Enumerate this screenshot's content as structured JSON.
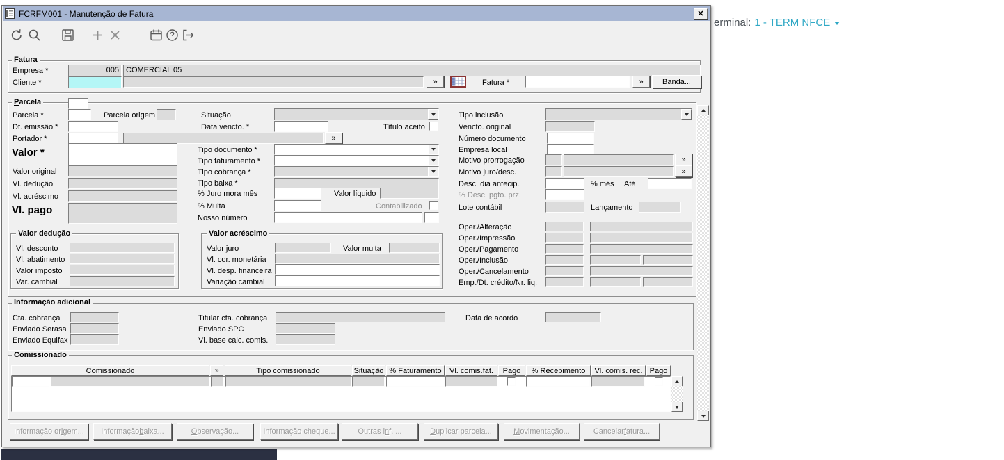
{
  "colors": {
    "titlebar": "#a7b6d3",
    "accent": "#2fa8c5",
    "field_readonly": "#dcdcdc",
    "field_highlight": "#b4f6f6",
    "navy_bar": "#2b3042"
  },
  "glyphs": {
    "lookup": "»",
    "close": "✕"
  },
  "window": {
    "title": "FCRFM001 - Manutenção de Fatura"
  },
  "background_app": {
    "terminal_label": "erminal:",
    "terminal_value": "1 - TERM NFCE"
  },
  "toolbar": {
    "icons": [
      "refresh",
      "search",
      "save",
      "add",
      "delete",
      "calendar",
      "help",
      "exit"
    ]
  },
  "fatura": {
    "group_label": "Fatura",
    "empresa_label": "Empresa *",
    "empresa_code": "005",
    "empresa_name": "COMERCIAL 05",
    "cliente_label": "Cliente *",
    "fatura_label": "Fatura *",
    "banda_button": "Banda..."
  },
  "parcela": {
    "group_label": "Parcela",
    "parcela_label": "Parcela *",
    "parcela_origem_label": "Parcela origem",
    "situacao_label": "Situação",
    "tipo_inclusao_label": "Tipo inclusão",
    "dt_emissao_label": "Dt. emissão *",
    "data_vencto_label": "Data vencto. *",
    "titulo_aceito_label": "Título aceito",
    "vencto_original_label": "Vencto. original",
    "portador_label": "Portador *",
    "numero_documento_label": "Número documento",
    "empresa_local_label": "Empresa local",
    "valor_label": "Valor *",
    "tipo_documento_label": "Tipo documento *",
    "tipo_faturamento_label": "Tipo faturamento *",
    "tipo_cobranca_label": "Tipo cobrança *",
    "tipo_baixa_label": "Tipo baixa *",
    "motivo_prorrogacao_label": "Motivo prorrogação",
    "motivo_juro_desc_label": "Motivo juro/desc.",
    "valor_original_label": "Valor original",
    "vl_deducao_label": "Vl. dedução",
    "vl_acrescimo_label": "Vl. acréscimo",
    "vl_pago_label": "Vl. pago",
    "desc_dia_antecip_label": "Desc. dia antecip.",
    "pct_mes_label": "% mês",
    "ate_label": "Até",
    "pct_desc_pgto_label": "% Desc. pgto. prz.",
    "juro_mora_label": "% Juro mora mês",
    "valor_liquido_label": "Valor líquido",
    "multa_label": "% Multa",
    "contabilizado_label": "Contabilizado",
    "nosso_numero_label": "Nosso número",
    "lote_contabil_label": "Lote contábil",
    "lancamento_label": "Lançamento",
    "oper_alteracao_label": "Oper./Alteração",
    "oper_impressao_label": "Oper./Impressão",
    "oper_pagamento_label": "Oper./Pagamento",
    "oper_inclusao_label": "Oper./Inclusão",
    "oper_cancelamento_label": "Oper./Cancelamento",
    "emp_dt_credito_label": "Emp./Dt. crédito/Nr. liq."
  },
  "valor_deducao": {
    "group_label": "Valor dedução",
    "vl_desconto_label": "Vl. desconto",
    "vl_abatimento_label": "Vl. abatimento",
    "valor_imposto_label": "Valor imposto",
    "var_cambial_label": "Var. cambial"
  },
  "valor_acrescimo": {
    "group_label": "Valor acréscimo",
    "valor_juro_label": "Valor juro",
    "valor_multa_label": "Valor multa",
    "vl_cor_monetaria_label": "Vl. cor. monetária",
    "vl_desp_financeira_label": "Vl. desp. financeira",
    "variacao_cambial_label": "Variação cambial"
  },
  "info_adicional": {
    "group_label": "Informação adicional",
    "cta_cobranca_label": "Cta. cobrança",
    "titular_cta_label": "Titular cta. cobrança",
    "data_acordo_label": "Data de acordo",
    "enviado_serasa_label": "Enviado Serasa",
    "enviado_spc_label": "Enviado SPC",
    "enviado_equifax_label": "Enviado Equifax",
    "vl_base_calc_label": "Vl. base calc. comis."
  },
  "comissionado": {
    "group_label": "Comissionado",
    "headers": [
      "Comissionado",
      "»",
      "Tipo comissionado",
      "Situação",
      "% Faturamento",
      "Vl. comis.fat.",
      "Pago",
      "% Recebimento",
      "Vl. comis. rec.",
      "Pago"
    ]
  },
  "footer_buttons": [
    {
      "label": "Informação origem..."
    },
    {
      "label": "Informação baixa..."
    },
    {
      "label": "Observação..."
    },
    {
      "label": "Informação cheque..."
    },
    {
      "label": "Outras inf. ..."
    },
    {
      "label": "Duplicar parcela..."
    },
    {
      "label": "Movimentação..."
    },
    {
      "label": "Cancelar fatura..."
    }
  ]
}
